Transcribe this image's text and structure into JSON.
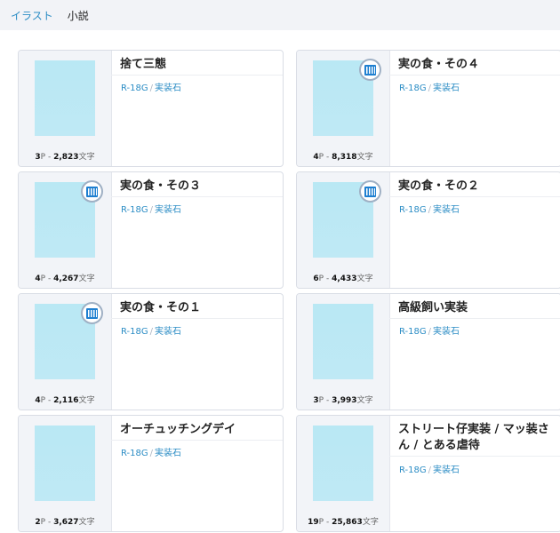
{
  "tabs": [
    {
      "label": "イラスト",
      "active": false
    },
    {
      "label": "小説",
      "active": true
    }
  ],
  "colors": {
    "accent": "#2c8dc5",
    "cover": "#b9e8f4",
    "card_left_bg": "#f2f4f8",
    "topbar_bg": "#f2f3f7"
  },
  "works": [
    {
      "title": "捨て三態",
      "tags": [
        "R-18G",
        "実装石"
      ],
      "pages": "3",
      "page_unit": "P",
      "chars": "2,823",
      "char_unit": "文字",
      "series": false
    },
    {
      "title": "実の食・その４",
      "tags": [
        "R-18G",
        "実装石"
      ],
      "pages": "4",
      "page_unit": "P",
      "chars": "8,318",
      "char_unit": "文字",
      "series": true
    },
    {
      "title": "実の食・その３",
      "tags": [
        "R-18G",
        "実装石"
      ],
      "pages": "4",
      "page_unit": "P",
      "chars": "4,267",
      "char_unit": "文字",
      "series": true
    },
    {
      "title": "実の食・その２",
      "tags": [
        "R-18G",
        "実装石"
      ],
      "pages": "6",
      "page_unit": "P",
      "chars": "4,433",
      "char_unit": "文字",
      "series": true
    },
    {
      "title": "実の食・その１",
      "tags": [
        "R-18G",
        "実装石"
      ],
      "pages": "4",
      "page_unit": "P",
      "chars": "2,116",
      "char_unit": "文字",
      "series": true
    },
    {
      "title": "高級飼い実装",
      "tags": [
        "R-18G",
        "実装石"
      ],
      "pages": "3",
      "page_unit": "P",
      "chars": "3,993",
      "char_unit": "文字",
      "series": false
    },
    {
      "title": "オーチュッチングデイ",
      "tags": [
        "R-18G",
        "実装石"
      ],
      "pages": "2",
      "page_unit": "P",
      "chars": "3,627",
      "char_unit": "文字",
      "series": false
    },
    {
      "title": "ストリート仔実装 / マッ装さん / とある虐待",
      "tags": [
        "R-18G",
        "実装石"
      ],
      "pages": "19",
      "page_unit": "P",
      "chars": "25,863",
      "char_unit": "文字",
      "series": false
    }
  ]
}
